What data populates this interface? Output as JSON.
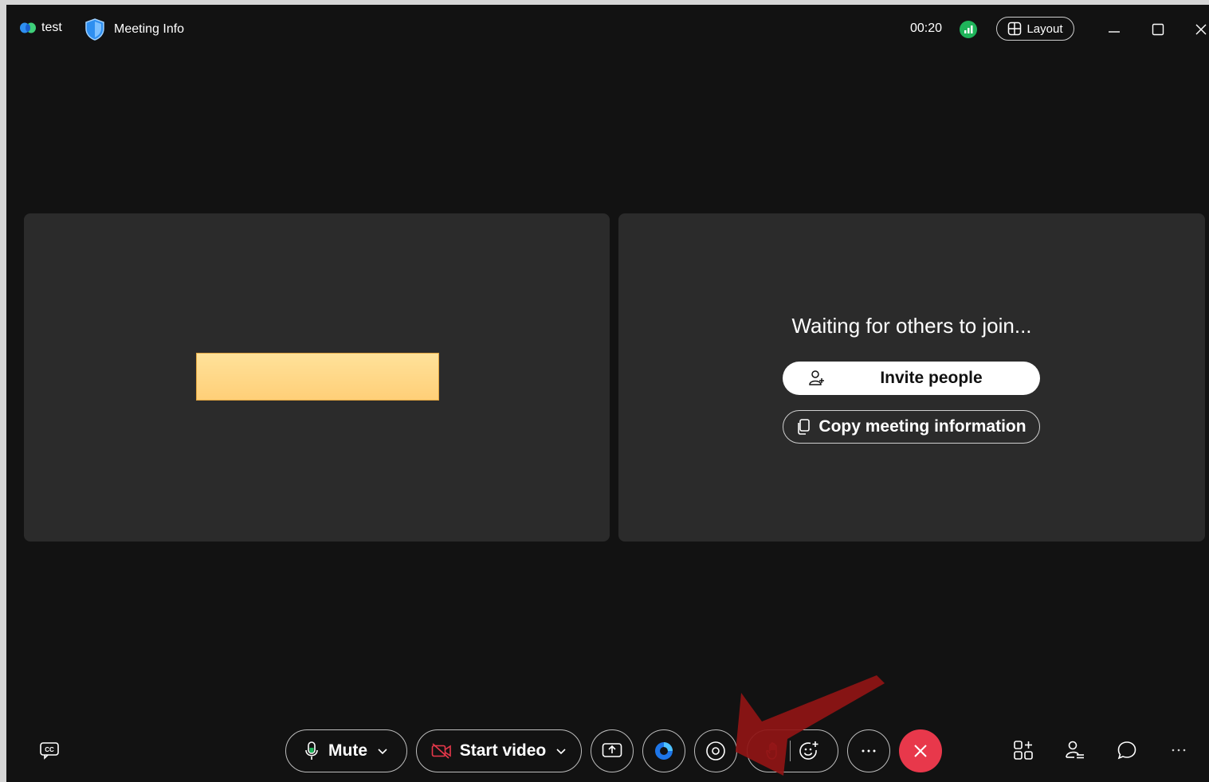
{
  "title_bar": {
    "app_name": "test",
    "meeting_info_label": "Meeting Info",
    "timer": "00:20",
    "layout_label": "Layout"
  },
  "stage": {
    "waiting_text": "Waiting for others to join...",
    "invite_label": "Invite people",
    "copy_label": "Copy meeting information"
  },
  "controls": {
    "mute_label": "Mute",
    "start_video_label": "Start video"
  },
  "colors": {
    "background": "#121212",
    "tile": "#2b2b2b",
    "end_call": "#e8384b",
    "signal_green": "#1fb45a",
    "shield_blue": "#2e8ff0",
    "annotation_arrow": "#8f1414",
    "redaction": "#ffd98a"
  },
  "icons": [
    "webex-logo-icon",
    "shield-icon",
    "signal-icon",
    "layout-grid-icon",
    "minimize-icon",
    "maximize-icon",
    "close-icon",
    "closed-caption-icon",
    "microphone-icon",
    "chevron-down-icon",
    "camera-off-icon",
    "share-screen-icon",
    "app-icon",
    "record-icon",
    "raise-hand-icon",
    "reaction-icon",
    "more-icon",
    "end-call-icon",
    "apps-icon",
    "participants-icon",
    "chat-icon",
    "more-options-icon",
    "invite-person-icon",
    "copy-icon"
  ]
}
